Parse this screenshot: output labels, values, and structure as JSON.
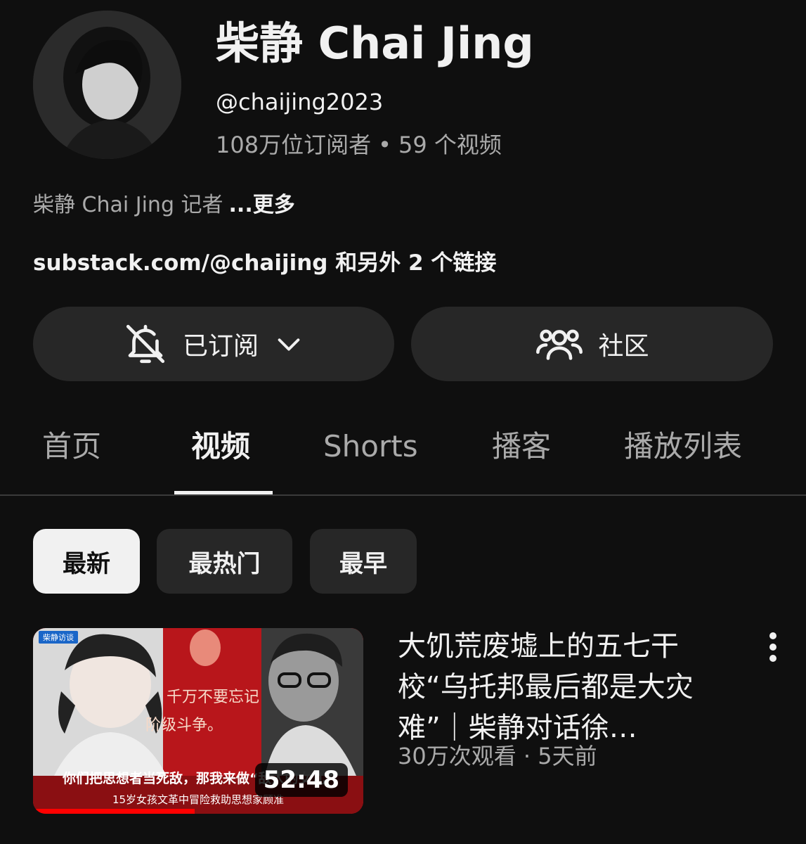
{
  "channel": {
    "name": "柴静 Chai Jing",
    "handle": "@chaijing2023",
    "subscribers": "108万位订阅者",
    "separator": "•",
    "video_count": "59 个视频",
    "description": "柴静 Chai Jing  记者",
    "more_label": "...更多",
    "links": "substack.com/@chaijing 和另外 2 个链接"
  },
  "actions": {
    "subscribed_label": "已订阅",
    "community_label": "社区"
  },
  "tabs": [
    {
      "label": "首页"
    },
    {
      "label": "视频"
    },
    {
      "label": "Shorts"
    },
    {
      "label": "播客"
    },
    {
      "label": "播放列表"
    }
  ],
  "active_tab": "视频",
  "filters": [
    {
      "label": "最新"
    },
    {
      "label": "最热门"
    },
    {
      "label": "最早"
    }
  ],
  "active_filter": "最新",
  "video": {
    "title": "大饥荒废墟上的五七干校“乌托邦最后都是大灾难”｜柴静对话徐…",
    "meta": "30万次观看 · 5天前",
    "duration": "52:48",
    "thumb_tag": "柴静访谈",
    "thumb_caption1": "你们把思想者当死敌，那我来做“敌人的女儿”",
    "thumb_caption2": "15岁女孩文革中冒险救助思想家顾准",
    "progress_fraction": 0.49
  },
  "colors": {
    "background": "#0f0f0f",
    "button": "#272727",
    "text": "#f1f1f1",
    "secondary_text": "#aaaaaa",
    "thumb_red": "#b8161b",
    "progress": "#ff0000"
  }
}
